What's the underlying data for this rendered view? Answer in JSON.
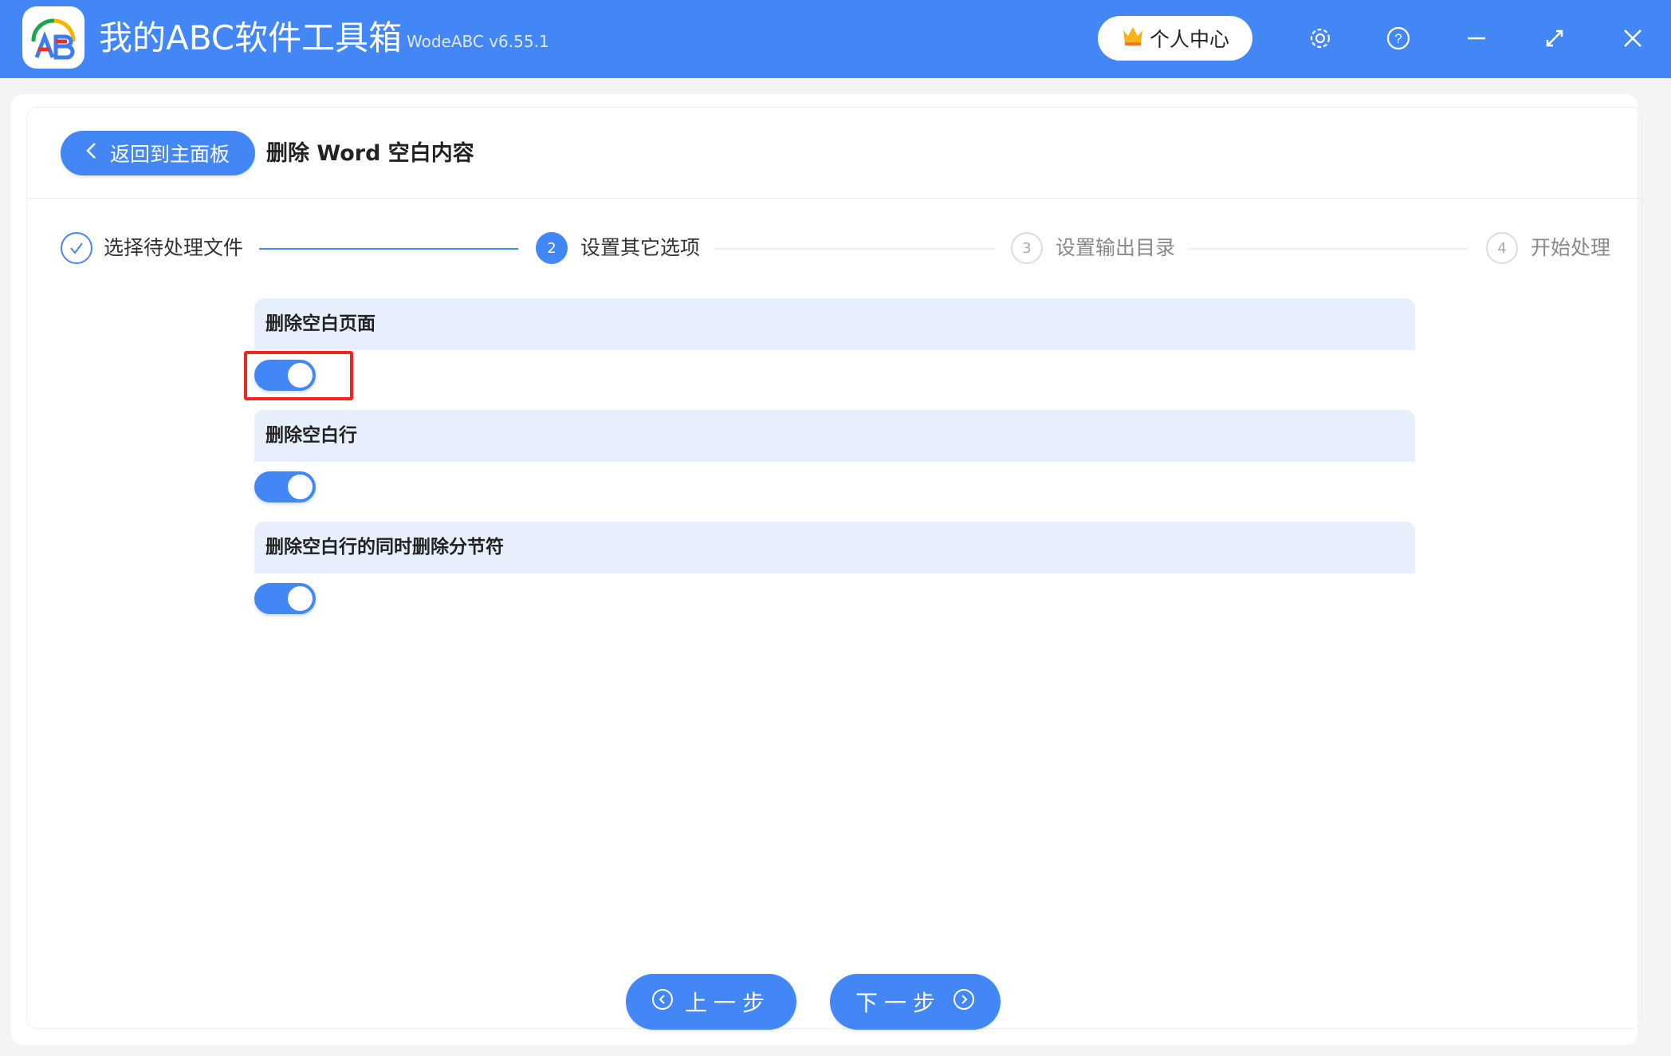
{
  "app": {
    "title": "我的ABC软件工具箱",
    "version": "WodeABC v6.55.1",
    "user_center": "个人中心"
  },
  "header": {
    "back_label": "返回到主面板",
    "title": "删除 Word 空白内容"
  },
  "steps": [
    {
      "number": "1",
      "label": "选择待处理文件",
      "state": "done"
    },
    {
      "number": "2",
      "label": "设置其它选项",
      "state": "active"
    },
    {
      "number": "3",
      "label": "设置输出目录",
      "state": "pending"
    },
    {
      "number": "4",
      "label": "开始处理",
      "state": "pending"
    }
  ],
  "options": [
    {
      "label": "删除空白页面",
      "enabled": true
    },
    {
      "label": "删除空白行",
      "enabled": true
    },
    {
      "label": "删除空白行的同时删除分节符",
      "enabled": true
    }
  ],
  "footer": {
    "prev_label": "上一步",
    "next_label": "下一步"
  },
  "colors": {
    "accent": "#4387f6",
    "highlight": "#f2241b",
    "section_bg": "#e8effc"
  }
}
